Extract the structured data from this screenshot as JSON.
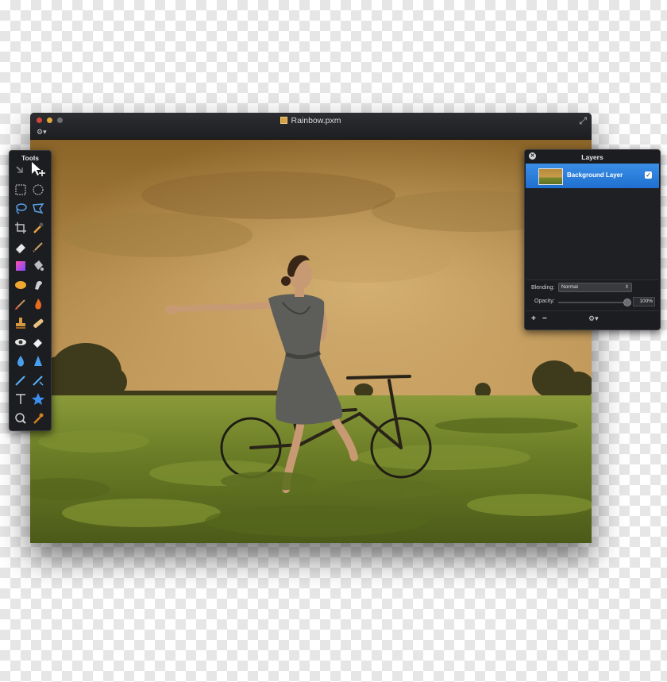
{
  "window": {
    "title": "Rainbow.pxm",
    "settings_icon": "gear-icon",
    "fullscreen_icon": "fullscreen-icon"
  },
  "tools_panel": {
    "title": "Tools",
    "items": [
      "arrange-tool",
      "move-tool",
      "rectangle-select-tool",
      "ellipse-select-tool",
      "lasso-tool",
      "polygon-lasso-tool",
      "crop-tool",
      "eyedropper-tool",
      "eraser-tool",
      "pencil-tool",
      "gradient-tool",
      "paint-bucket-tool",
      "sponge-tool",
      "smudge-tool",
      "brush-tool",
      "burn-tool",
      "clone-stamp-tool",
      "heal-tool",
      "red-eye-tool",
      "erase-tool",
      "blur-tool",
      "sharpen-tool",
      "pen-tool",
      "freeform-pen-tool",
      "type-tool",
      "shape-tool",
      "zoom-tool",
      "color-picker-tool"
    ]
  },
  "layers_panel": {
    "title": "Layers",
    "layers": [
      {
        "name": "Background Layer",
        "visible": true,
        "selected": true
      }
    ],
    "blending_label": "Blending:",
    "blending_value": "Normal",
    "opacity_label": "Opacity:",
    "opacity_value": "100%",
    "add_label": "+",
    "remove_label": "−"
  },
  "colors": {
    "selection_blue": "#2a7fe0",
    "panel_bg": "#1c1d20"
  }
}
